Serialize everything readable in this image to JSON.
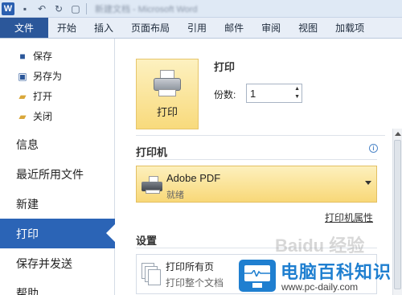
{
  "window": {
    "app_logo_letter": "W",
    "title_blurred": "新建文档 - Microsoft Word"
  },
  "quick_access": {
    "icons": [
      "save-icon",
      "undo-icon",
      "redo-icon",
      "print-preview-icon"
    ]
  },
  "ribbon_tabs": [
    "文件",
    "开始",
    "插入",
    "页面布局",
    "引用",
    "邮件",
    "审阅",
    "视图",
    "加载项"
  ],
  "left_menu": {
    "small_items": [
      {
        "label": "保存",
        "icon": "save-icon"
      },
      {
        "label": "另存为",
        "icon": "save-as-icon"
      },
      {
        "label": "打开",
        "icon": "open-folder-icon"
      },
      {
        "label": "关闭",
        "icon": "close-folder-icon"
      }
    ],
    "big_items": [
      "信息",
      "最近所用文件",
      "新建",
      "打印",
      "保存并发送",
      "帮助"
    ],
    "active": "打印"
  },
  "print": {
    "section_title": "打印",
    "button_label": "打印",
    "copies_label": "份数:",
    "copies_value": "1"
  },
  "printer": {
    "section_title": "打印机",
    "name": "Adobe PDF",
    "status": "就绪",
    "properties_link": "打印机属性"
  },
  "settings": {
    "section_title": "设置",
    "pages_title": "打印所有页",
    "pages_subtitle": "打印整个文档"
  },
  "watermark": {
    "title": "电脑百科知识",
    "url": "www.pc-daily.com",
    "baidu": "Baidu 经验"
  },
  "colors": {
    "file_tab": "#2b579a",
    "active_menu": "#2b64b6",
    "highlight_yellow": "#f8da7c",
    "watermark_blue": "#1f7fd0"
  }
}
